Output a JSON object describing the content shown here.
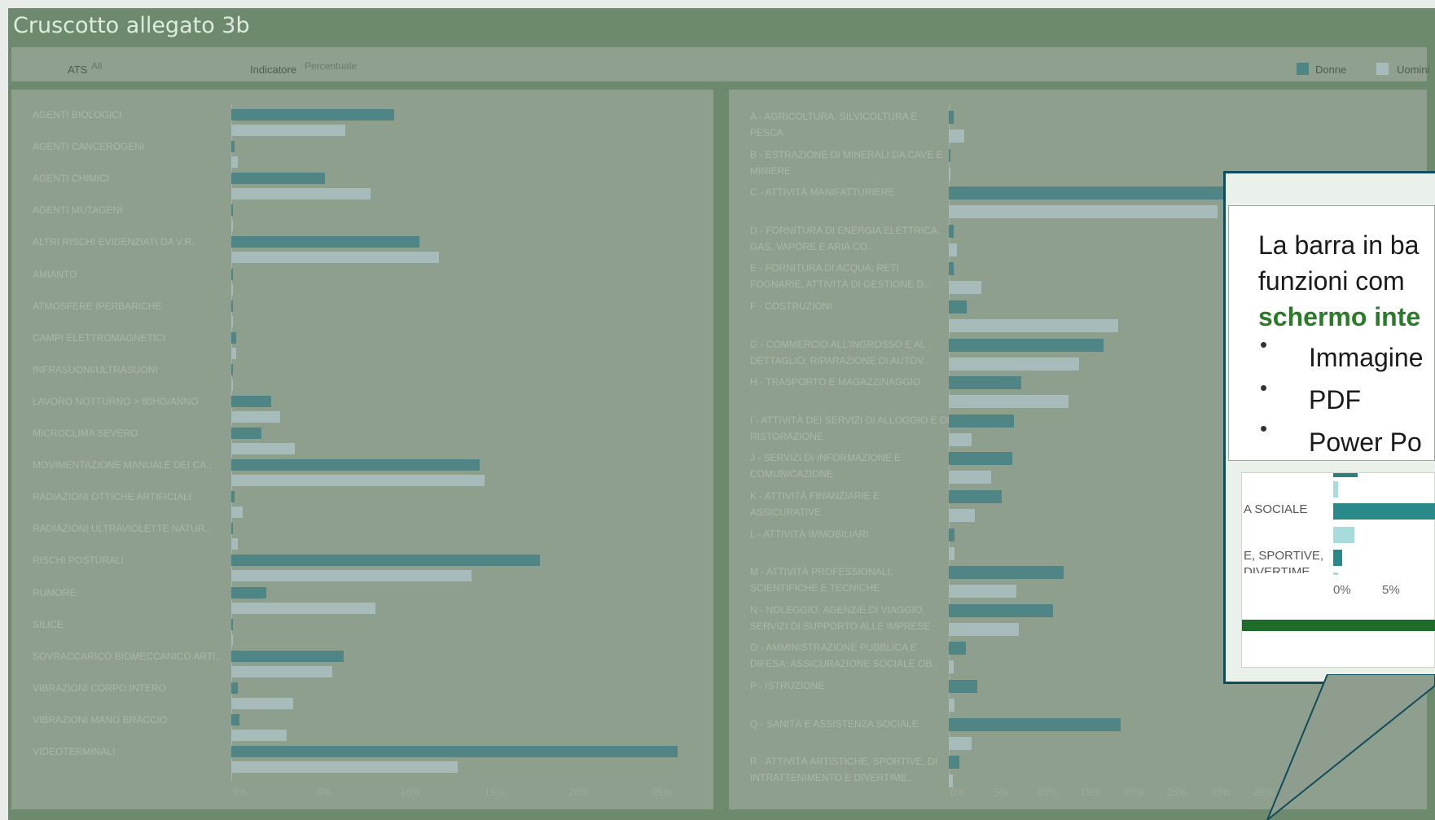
{
  "dashboard": {
    "title": "Cruscotto allegato 3b",
    "filters": [
      {
        "label": "ATS",
        "value": "All"
      },
      {
        "label": "Indicatore",
        "value": "Percentuale"
      }
    ],
    "legend": [
      {
        "label": "Donne",
        "color": "#4f8585"
      },
      {
        "label": "Uomini",
        "color": "#a7bbbb"
      }
    ]
  },
  "chart_data": [
    {
      "type": "bar",
      "orientation": "horizontal",
      "categories": [
        "AGENTI BIOLOGICI",
        "AGENTI CANCEROGENI",
        "AGENTI CHIMICI",
        "AGENTI MUTAGENI",
        "ALTRI RISCHI EVIDENZIATI DA V.R.",
        "AMIANTO",
        "ATMOSFERE IPERBARICHE",
        "CAMPI ELETTROMAGNETICI",
        "INFRASUONI/ULTRASUONI",
        "LAVORO NOTTURNO > 80HG/ANNO",
        "MICROCLIMA SEVERO",
        "MOVIMENTAZIONE MANUALE DEI CA..",
        "RADIAZIONI OTTICHE ARTIFICIALI",
        "RADIAZIONI ULTRAVIOLETTE NATUR..",
        "RISCHI POSTURALI",
        "RUMORE",
        "SILICE",
        "SOVRACCARICO BIOMECCANICO ARTI..",
        "VIBRAZIONI CORPO INTERO",
        "VIBRAZIONI MANO BRACCIO",
        "VIDEOTERMINALI"
      ],
      "series": [
        {
          "name": "Donne",
          "values": [
            9.7,
            0.2,
            5.6,
            0.1,
            11.2,
            0.1,
            0.1,
            0.3,
            0.1,
            2.4,
            1.8,
            14.8,
            0.2,
            0.1,
            18.4,
            2.1,
            0.1,
            6.7,
            0.4,
            0.5,
            26.6
          ]
        },
        {
          "name": "Uomini",
          "values": [
            6.8,
            0.4,
            8.3,
            0.1,
            12.4,
            0.1,
            0.1,
            0.3,
            0.1,
            2.9,
            3.8,
            15.1,
            0.7,
            0.4,
            14.3,
            8.6,
            0.1,
            6.0,
            3.7,
            3.3,
            13.5
          ]
        }
      ],
      "x_ticks": [
        "0%",
        "5%",
        "10%",
        "15%",
        "20%",
        "25%"
      ],
      "xlim": [
        0,
        28
      ]
    },
    {
      "type": "bar",
      "orientation": "horizontal",
      "categories": [
        "A - AGRICOLTURA, SILVICOLTURA E PESCA",
        "B - ESTRAZIONE DI MINERALI DA CAVE E MINIERE",
        "C - ATTIVITÀ MANIFATTURIERE",
        "D - FORNITURA DI ENERGIA ELETTRICA, GAS, VAPORE E ARIA CO..",
        "E - FORNITURA DI ACQUA; RETI FOGNARIE, ATTIVITÀ DI GESTIONE D..",
        "F - COSTRUZIONI",
        "G - COMMERCIO ALL'INGROSSO E AL DETTAGLIO; RIPARAZIONE DI AUTOV..",
        "H - TRASPORTO E MAGAZZINAGGIO",
        "I - ATTIVITÀ DEI SERVIZI DI ALLOGGIO E DI RISTORAZIONE",
        "J - SERVIZI DI INFORMAZIONE E COMUNICAZIONE",
        "K - ATTIVITÀ FINANZIARIE E ASSICURATIVE",
        "L - ATTIVITÀ IMMOBILIARI",
        "M - ATTIVITÀ PROFESSIONALI, SCIENTIFICHE E TECNICHE",
        "N - NOLEGGIO, AGENZIE DI VIAGGIO, SERVIZI DI SUPPORTO ALLE IMPRESE",
        "O - AMMINISTRAZIONE PUBBLICA E DIFESA; ASSICURAZIONE SOCIALE OB..",
        "P - ISTRUZIONE",
        "Q - SANITÀ E ASSISTENZA SOCIALE",
        "R - ATTIVITÀ ARTISTICHE, SPORTIVE, DI INTRATTENIMENTO E DIVERTIME.."
      ],
      "series": [
        {
          "name": "Donne",
          "values": [
            0.6,
            0.1,
            33.5,
            0.6,
            0.6,
            2.1,
            17.8,
            8.4,
            7.5,
            7.3,
            6.1,
            0.7,
            13.2,
            12.0,
            2.0,
            3.3,
            19.8,
            1.2
          ]
        },
        {
          "name": "Uomini",
          "values": [
            1.8,
            0.1,
            31.0,
            0.9,
            3.8,
            19.5,
            15.0,
            13.8,
            2.6,
            4.9,
            3.0,
            0.7,
            7.8,
            8.1,
            0.6,
            0.7,
            2.6,
            0.5
          ]
        }
      ],
      "x_ticks": [
        "0%",
        "5%",
        "10%",
        "15%",
        "20%",
        "25%",
        "30%",
        "35%"
      ],
      "xlim": [
        0,
        37
      ]
    }
  ],
  "popup": {
    "lines": [
      "La barra in ba",
      "funzioni com",
      "schermo inte"
    ],
    "bullets": [
      "Immagine",
      "PDF",
      "Power Po"
    ],
    "mini_labels": [
      "A SOCIALE",
      "E, SPORTIVE,",
      "DIVERTIME"
    ],
    "mini_ticks": [
      "0%",
      "5%"
    ]
  }
}
